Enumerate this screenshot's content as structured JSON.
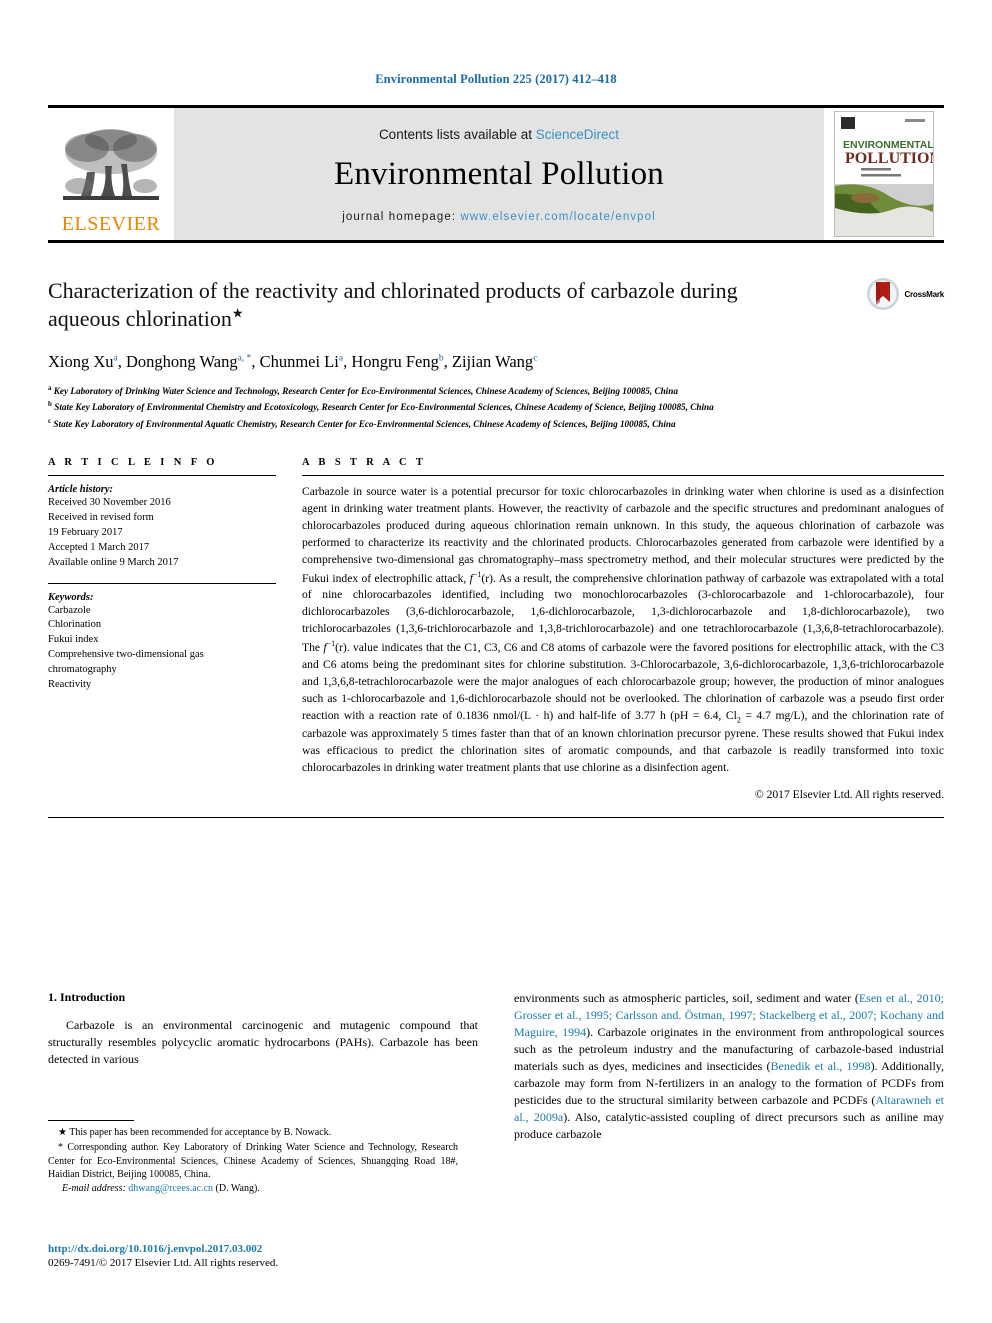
{
  "running_head": "Environmental Pollution 225 (2017) 412–418",
  "masthead": {
    "contents_prefix": "Contents lists available at ",
    "sciencedirect": "ScienceDirect",
    "journal_title": "Environmental Pollution",
    "homepage_prefix": "journal homepage: ",
    "homepage_url": "www.elsevier.com/locate/envpol",
    "publisher_wordmark": "ELSEVIER",
    "cover_line1": "ENVIRONMENTAL",
    "cover_line2": "POLLUTION",
    "colors": {
      "link": "#3a8fc4",
      "elsevier_orange": "#ef8200",
      "band": "#e3e3e3",
      "running_head": "#1a6ca0"
    }
  },
  "article": {
    "title": "Characterization of the reactivity and chlorinated products of carbazole during aqueous chlorination",
    "title_footnote_mark": "★",
    "crossmark_label": "CrossMark",
    "authors": [
      {
        "name": "Xiong Xu",
        "sup": "a"
      },
      {
        "name": "Donghong Wang",
        "sup": "a, *"
      },
      {
        "name": "Chunmei Li",
        "sup": "a"
      },
      {
        "name": "Hongru Feng",
        "sup": "b"
      },
      {
        "name": "Zijian Wang",
        "sup": "c"
      }
    ],
    "affiliations": [
      {
        "mark": "a",
        "text": "Key Laboratory of Drinking Water Science and Technology, Research Center for Eco-Environmental Sciences, Chinese Academy of Sciences, Beijing 100085, China"
      },
      {
        "mark": "b",
        "text": "State Key Laboratory of Environmental Chemistry and Ecotoxicology, Research Center for Eco-Environmental Sciences, Chinese Academy of Science, Beijing 100085, China"
      },
      {
        "mark": "c",
        "text": "State Key Laboratory of Environmental Aquatic Chemistry, Research Center for Eco-Environmental Sciences, Chinese Academy of Sciences, Beijing 100085, China"
      }
    ]
  },
  "article_info": {
    "heading": "A R T I C L E   I N F O",
    "history_heading": "Article history:",
    "history": [
      "Received 30 November 2016",
      "Received in revised form",
      "19 February 2017",
      "Accepted 1 March 2017",
      "Available online 9 March 2017"
    ],
    "keywords_heading": "Keywords:",
    "keywords": [
      "Carbazole",
      "Chlorination",
      "Fukui index",
      "Comprehensive two-dimensional gas",
      "chromatography",
      "Reactivity"
    ]
  },
  "abstract": {
    "heading": "A B S T R A C T",
    "paragraph_part1": "Carbazole in source water is a potential precursor for toxic chlorocarbazoles in drinking water when chlorine is used as a disinfection agent in drinking water treatment plants. However, the reactivity of carbazole and the specific structures and predominant analogues of chlorocarbazoles produced during aqueous chlorination remain unknown. In this study, the aqueous chlorination of carbazole was performed to characterize its reactivity and the chlorinated products. Chlorocarbazoles generated from carbazole were identified by a comprehensive two-dimensional gas chromatography–mass spectrometry method, and their molecular structures were predicted by the Fukui index of electrophilic attack, ",
    "fukui_symbol": "f",
    "fukui_exponent": "−1",
    "fukui_arg": "(r).",
    "paragraph_part2": " As a result, the comprehensive chlorination pathway of carbazole was extrapolated with a total of nine chlorocarbazoles identified, including two monochlorocarbazoles (3-chlorocarbazole and 1-chlorocarbazole), four dichlorocarbazoles (3,6-dichlorocarbazole, 1,6-dichlorocarbazole, 1,3-dichlorocarbazole and 1,8-dichlorocarbazole), two trichlorocarbazoles (1,3,6-trichlorocarbazole and 1,3,8-trichlorocarbazole) and one tetrachlorocarbazole (1,3,6,8-tetrachlorocarbazole). The ",
    "paragraph_part3": " value indicates that the C1, C3, C6 and C8 atoms of carbazole were the favored positions for electrophilic attack, with the C3 and C6 atoms being the predominant sites for chlorine substitution. 3-Chlorocarbazole, 3,6-dichlorocarbazole, 1,3,6-trichlorocarbazole and 1,3,6,8-tetrachlorocarbazole were the major analogues of each chlorocarbazole group; however, the production of minor analogues such as 1-chlorocarbazole and 1,6-dichlorocarbazole should not be overlooked. The chlorination of carbazole was a pseudo first order reaction with a reaction rate of 0.1836 nmol/(L · h) and half-life of 3.77 h (pH = 6.4, Cl",
    "cl_subscript": "2",
    "paragraph_part4": " = 4.7 mg/L), and the chlorination rate of carbazole was approximately 5 times faster than that of an known chlorination precursor pyrene. These results showed that Fukui index was efficacious to predict the chlorination sites of aromatic compounds, and that carbazole is readily transformed into toxic chlorocarbazoles in drinking water treatment plants that use chlorine as a disinfection agent.",
    "copyright": "© 2017 Elsevier Ltd. All rights reserved."
  },
  "introduction": {
    "heading": "1. Introduction",
    "left_paragraph": "Carbazole is an environmental carcinogenic and mutagenic compound that structurally resembles polycyclic aromatic hydrocarbons (PAHs). Carbazole has been detected in various",
    "right_column": {
      "text_a": "environments such as atmospheric particles, soil, sediment and water (",
      "ref_1": "Esen et al., 2010; Grosser et al., 1995; Carlsson and. Östman, 1997; Stackelberg et al., 2007; Kochany and Maguire, 1994",
      "text_b": "). Carbazole originates in the environment from anthropological sources such as the petroleum industry and the manufacturing of carbazole-based industrial materials such as dyes, medicines and insecticides (",
      "ref_2": "Benedik et al., 1998",
      "text_c": "). Additionally, carbazole may form from N-fertilizers in an analogy to the formation of PCDFs from pesticides due to the structural similarity between carbazole and PCDFs (",
      "ref_3": "Altarawneh et al., 2009a",
      "text_d": "). Also, catalytic-assisted coupling of direct precursors such as aniline may produce carbazole"
    }
  },
  "footnotes": {
    "star_note": "This paper has been recommended for acceptance by B. Nowack.",
    "star_mark": "★",
    "corr_mark": "*",
    "corr_note": "Corresponding author. Key Laboratory of Drinking Water Science and Technology, Research Center for Eco-Environmental Sciences, Chinese Academy of Sciences, Shuangqing Road 18#, Haidian District, Beijing 100085, China.",
    "email_label": "E-mail address:",
    "email": "dhwang@rcees.ac.cn",
    "email_suffix": "(D. Wang).",
    "doi": "http://dx.doi.org/10.1016/j.envpol.2017.03.002",
    "issn_line": "0269-7491/© 2017 Elsevier Ltd. All rights reserved."
  }
}
